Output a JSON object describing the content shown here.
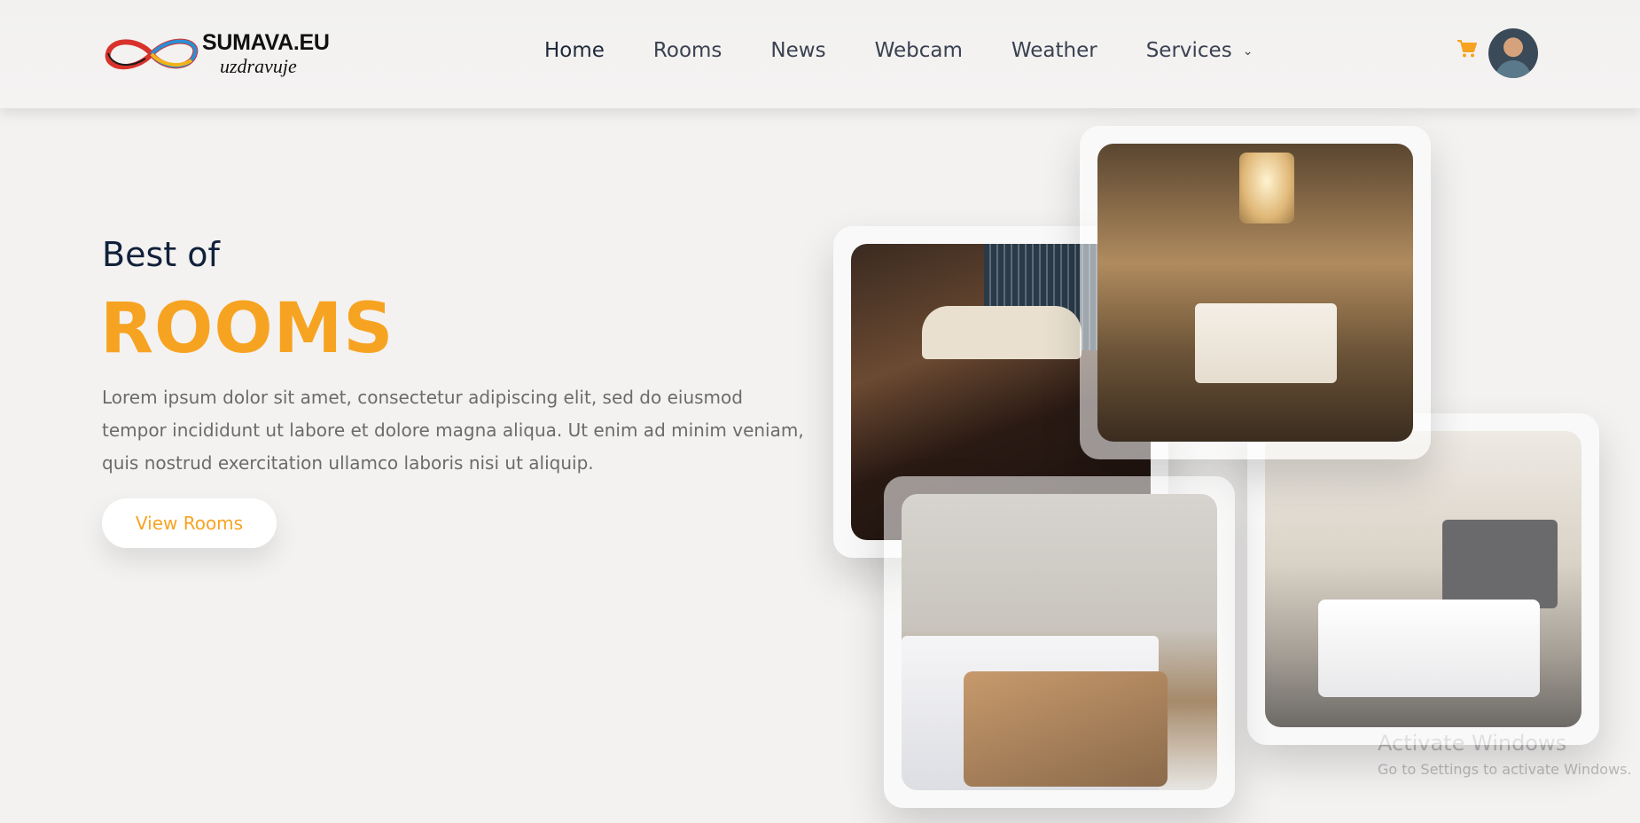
{
  "header": {
    "logo": {
      "title": "SUMAVA.EU",
      "subtitle": "uzdravuje"
    },
    "nav": [
      {
        "label": "Home"
      },
      {
        "label": "Rooms"
      },
      {
        "label": "News"
      },
      {
        "label": "Webcam"
      },
      {
        "label": "Weather"
      },
      {
        "label": "Services"
      }
    ],
    "cart_icon": "shopping-cart-icon",
    "avatar_icon": "user-avatar"
  },
  "hero": {
    "kicker": "Best of",
    "headline": "ROOMS",
    "paragraph": "Lorem ipsum dolor sit amet, consectetur adipiscing elit, sed do eiusmod tempor incididunt ut labore et dolore magna aliqua. Ut enim ad minim veniam, quis nostrud exercitation ullamco laboris nisi ut aliquip.",
    "cta_label": "View Rooms"
  },
  "colors": {
    "accent": "#f7a322",
    "heading": "#12213a"
  },
  "watermark": {
    "line1": "Activate Windows",
    "line2": "Go to Settings to activate Windows."
  }
}
